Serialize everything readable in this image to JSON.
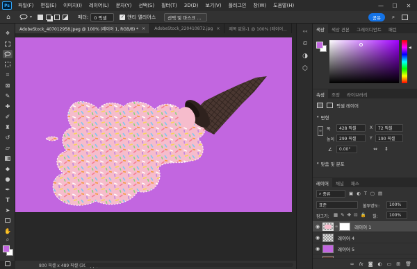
{
  "app": {
    "logo": "Ps"
  },
  "menu": [
    "파일(F)",
    "편집(E)",
    "이미지(I)",
    "레이어(L)",
    "문자(Y)",
    "선택(S)",
    "필터(T)",
    "3D(D)",
    "보기(V)",
    "플러그인",
    "창(W)",
    "도움말(H)"
  ],
  "window_controls": {
    "minimize": "—",
    "maximize": "☐",
    "close": "✕"
  },
  "options": {
    "feather_label": "페더:",
    "feather_value": "0 픽셀",
    "antialias_label": "앤티 앨리어스",
    "select_mask_label": "선택 및 마스크 ...",
    "share_label": "공유"
  },
  "doc_tabs": [
    {
      "label": "AdobeStock_407012958.jpeg @ 100% (레이어 1, RGB/8) *",
      "active": true
    },
    {
      "label": "AdobeStock_220410872.jpg",
      "active": false
    },
    {
      "label": "제목 없음-1 @ 100% (레이어...",
      "active": false
    }
  ],
  "status": {
    "text": "800 픽셀 x 489 픽셀 (300 ppi)"
  },
  "color_panel": {
    "tabs": [
      "색상",
      "색상 견본",
      "그레이디언트",
      "패턴"
    ]
  },
  "properties_panel": {
    "tabs": [
      "속성",
      "조정",
      "라이브러리"
    ],
    "layer_type": "픽셀 레이어",
    "transform_label": "변형",
    "w_label": "폭",
    "w_value": "428 픽셀",
    "h_label": "높이",
    "h_value": "299 픽셀",
    "x_label": "X",
    "x_value": "72 픽셀",
    "y_label": "Y",
    "y_value": "190 픽셀",
    "angle_value": "0.00°",
    "align_label": "맞춤 및 분포"
  },
  "layers_panel": {
    "tabs": [
      "레이어",
      "채널",
      "패스"
    ],
    "kind_label": "종류",
    "blend_mode": "표준",
    "opacity_label": "불투명도:",
    "opacity_value": "100%",
    "lock_label": "잠그기:",
    "fill_label": "칠:",
    "fill_value": "100%",
    "layers": [
      {
        "name": "레이어 1",
        "selected": true
      },
      {
        "name": "레이어 4",
        "selected": false
      },
      {
        "name": "레이어 5",
        "selected": false
      },
      {
        "name": "배경",
        "selected": false
      }
    ],
    "footer_icons": [
      "link-icon",
      "fx-icon",
      "mask-icon",
      "adjustment-icon",
      "group-icon",
      "new-layer-icon",
      "trash-icon"
    ]
  },
  "colors": {
    "canvas_bg": "#c266e0",
    "accent": "#1473e6",
    "foreground": "#c266e0",
    "background": "#ffffff"
  }
}
